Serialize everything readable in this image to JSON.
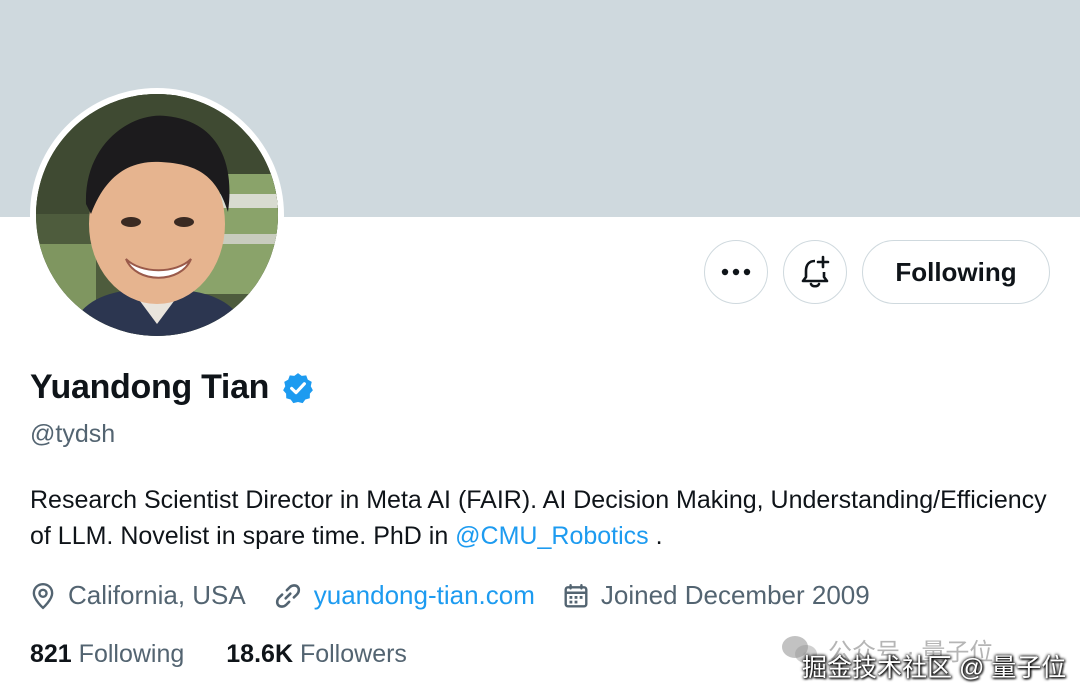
{
  "profile": {
    "display_name": "Yuandong Tian",
    "handle": "@tydsh",
    "bio_text": "Research Scientist Director in Meta AI (FAIR). AI Decision Making, Understanding/Efficiency of LLM. Novelist in spare time. PhD in ",
    "bio_mention": "@CMU_Robotics",
    "bio_end": " .",
    "location": "California, USA",
    "website": "yuandong-tian.com",
    "joined": "Joined December 2009"
  },
  "actions": {
    "follow_label": "Following"
  },
  "stats": {
    "following_count": "821",
    "following_label": "Following",
    "followers_count": "18.6K",
    "followers_label": "Followers"
  },
  "watermark": {
    "top": "公众号 · 量子位",
    "bottom": "掘金技术社区 @ 量子位"
  },
  "colors": {
    "banner": "#cfd9de",
    "link": "#1d9bf0",
    "secondary_text": "#536471",
    "verified_badge": "#1d9bf0"
  }
}
